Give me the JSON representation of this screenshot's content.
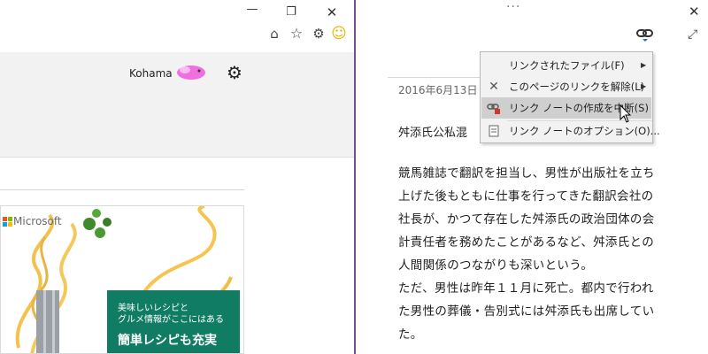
{
  "browser": {
    "user_name": "Kohama"
  },
  "ad": {
    "brand": "Microsoft",
    "line1": "美味しいレシピと",
    "line2": "グルメ情報がここにはある",
    "line3": "簡単レシピも充実"
  },
  "note": {
    "date": "2016年6月13日",
    "title": "舛添氏公私混",
    "body": [
      "競馬雑誌で翻訳を担当し、男性が出版社を立ち",
      "上げた後もともに仕事を行ってきた翻訳会社の",
      "社長が、かつて存在した舛添氏の政治団体の会",
      "計責任者を務めたことがあるなど、舛添氏との",
      "人間関係のつながりも深いという。",
      "ただ、男性は昨年１１月に死亡。都内で行われ",
      "た男性の葬儀・告別式には舛添氏も出席してい",
      "た。"
    ]
  },
  "context_menu": {
    "items": [
      {
        "label": "リンクされたファイル(F)",
        "icon": "none",
        "has_submenu": true
      },
      {
        "label": "このページのリンクを解除(L)",
        "icon": "x-icon",
        "has_submenu": true
      },
      {
        "label": "リンク ノートの作成を中断(S)",
        "icon": "pause-link-icon",
        "has_submenu": false,
        "highlighted": true
      },
      {
        "label": "リンク ノートのオプション(O)...",
        "icon": "options-icon",
        "has_submenu": false
      }
    ]
  },
  "colors": {
    "accent_purple": "#7b4a94",
    "ad_green": "#107c64",
    "menu_highlight": "#cfcfcf"
  }
}
